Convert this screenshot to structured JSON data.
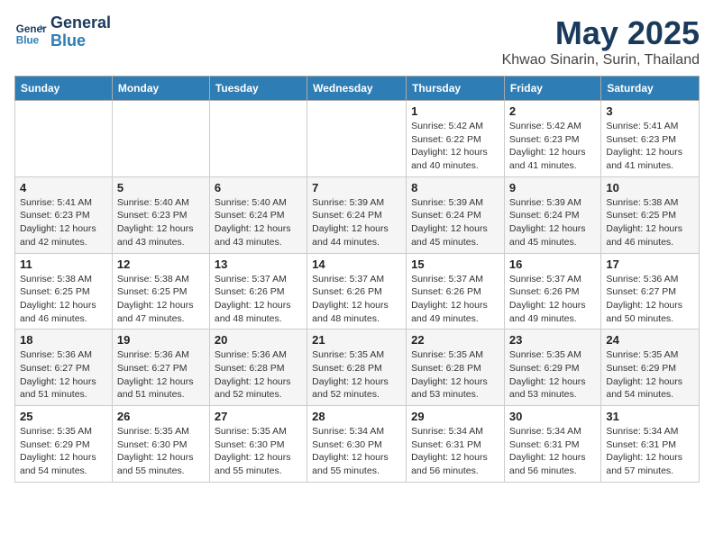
{
  "header": {
    "logo_line1": "General",
    "logo_line2": "Blue",
    "month": "May 2025",
    "location": "Khwao Sinarin, Surin, Thailand"
  },
  "days_of_week": [
    "Sunday",
    "Monday",
    "Tuesday",
    "Wednesday",
    "Thursday",
    "Friday",
    "Saturday"
  ],
  "weeks": [
    [
      {
        "day": "",
        "info": ""
      },
      {
        "day": "",
        "info": ""
      },
      {
        "day": "",
        "info": ""
      },
      {
        "day": "",
        "info": ""
      },
      {
        "day": "1",
        "info": "Sunrise: 5:42 AM\nSunset: 6:22 PM\nDaylight: 12 hours\nand 40 minutes."
      },
      {
        "day": "2",
        "info": "Sunrise: 5:42 AM\nSunset: 6:23 PM\nDaylight: 12 hours\nand 41 minutes."
      },
      {
        "day": "3",
        "info": "Sunrise: 5:41 AM\nSunset: 6:23 PM\nDaylight: 12 hours\nand 41 minutes."
      }
    ],
    [
      {
        "day": "4",
        "info": "Sunrise: 5:41 AM\nSunset: 6:23 PM\nDaylight: 12 hours\nand 42 minutes."
      },
      {
        "day": "5",
        "info": "Sunrise: 5:40 AM\nSunset: 6:23 PM\nDaylight: 12 hours\nand 43 minutes."
      },
      {
        "day": "6",
        "info": "Sunrise: 5:40 AM\nSunset: 6:24 PM\nDaylight: 12 hours\nand 43 minutes."
      },
      {
        "day": "7",
        "info": "Sunrise: 5:39 AM\nSunset: 6:24 PM\nDaylight: 12 hours\nand 44 minutes."
      },
      {
        "day": "8",
        "info": "Sunrise: 5:39 AM\nSunset: 6:24 PM\nDaylight: 12 hours\nand 45 minutes."
      },
      {
        "day": "9",
        "info": "Sunrise: 5:39 AM\nSunset: 6:24 PM\nDaylight: 12 hours\nand 45 minutes."
      },
      {
        "day": "10",
        "info": "Sunrise: 5:38 AM\nSunset: 6:25 PM\nDaylight: 12 hours\nand 46 minutes."
      }
    ],
    [
      {
        "day": "11",
        "info": "Sunrise: 5:38 AM\nSunset: 6:25 PM\nDaylight: 12 hours\nand 46 minutes."
      },
      {
        "day": "12",
        "info": "Sunrise: 5:38 AM\nSunset: 6:25 PM\nDaylight: 12 hours\nand 47 minutes."
      },
      {
        "day": "13",
        "info": "Sunrise: 5:37 AM\nSunset: 6:26 PM\nDaylight: 12 hours\nand 48 minutes."
      },
      {
        "day": "14",
        "info": "Sunrise: 5:37 AM\nSunset: 6:26 PM\nDaylight: 12 hours\nand 48 minutes."
      },
      {
        "day": "15",
        "info": "Sunrise: 5:37 AM\nSunset: 6:26 PM\nDaylight: 12 hours\nand 49 minutes."
      },
      {
        "day": "16",
        "info": "Sunrise: 5:37 AM\nSunset: 6:26 PM\nDaylight: 12 hours\nand 49 minutes."
      },
      {
        "day": "17",
        "info": "Sunrise: 5:36 AM\nSunset: 6:27 PM\nDaylight: 12 hours\nand 50 minutes."
      }
    ],
    [
      {
        "day": "18",
        "info": "Sunrise: 5:36 AM\nSunset: 6:27 PM\nDaylight: 12 hours\nand 51 minutes."
      },
      {
        "day": "19",
        "info": "Sunrise: 5:36 AM\nSunset: 6:27 PM\nDaylight: 12 hours\nand 51 minutes."
      },
      {
        "day": "20",
        "info": "Sunrise: 5:36 AM\nSunset: 6:28 PM\nDaylight: 12 hours\nand 52 minutes."
      },
      {
        "day": "21",
        "info": "Sunrise: 5:35 AM\nSunset: 6:28 PM\nDaylight: 12 hours\nand 52 minutes."
      },
      {
        "day": "22",
        "info": "Sunrise: 5:35 AM\nSunset: 6:28 PM\nDaylight: 12 hours\nand 53 minutes."
      },
      {
        "day": "23",
        "info": "Sunrise: 5:35 AM\nSunset: 6:29 PM\nDaylight: 12 hours\nand 53 minutes."
      },
      {
        "day": "24",
        "info": "Sunrise: 5:35 AM\nSunset: 6:29 PM\nDaylight: 12 hours\nand 54 minutes."
      }
    ],
    [
      {
        "day": "25",
        "info": "Sunrise: 5:35 AM\nSunset: 6:29 PM\nDaylight: 12 hours\nand 54 minutes."
      },
      {
        "day": "26",
        "info": "Sunrise: 5:35 AM\nSunset: 6:30 PM\nDaylight: 12 hours\nand 55 minutes."
      },
      {
        "day": "27",
        "info": "Sunrise: 5:35 AM\nSunset: 6:30 PM\nDaylight: 12 hours\nand 55 minutes."
      },
      {
        "day": "28",
        "info": "Sunrise: 5:34 AM\nSunset: 6:30 PM\nDaylight: 12 hours\nand 55 minutes."
      },
      {
        "day": "29",
        "info": "Sunrise: 5:34 AM\nSunset: 6:31 PM\nDaylight: 12 hours\nand 56 minutes."
      },
      {
        "day": "30",
        "info": "Sunrise: 5:34 AM\nSunset: 6:31 PM\nDaylight: 12 hours\nand 56 minutes."
      },
      {
        "day": "31",
        "info": "Sunrise: 5:34 AM\nSunset: 6:31 PM\nDaylight: 12 hours\nand 57 minutes."
      }
    ]
  ]
}
